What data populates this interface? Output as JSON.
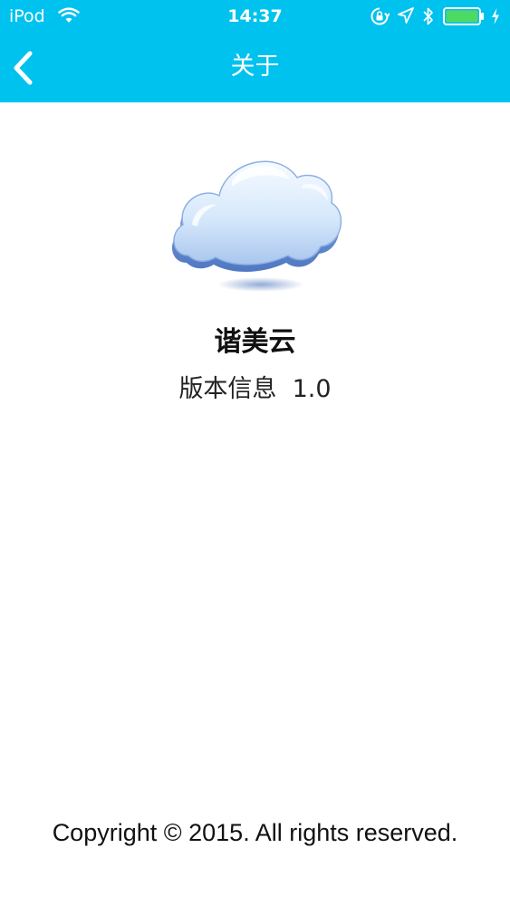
{
  "status_bar": {
    "carrier": "iPod",
    "time": "14:37",
    "icons": [
      "wifi-icon",
      "rotation-lock-icon",
      "location-icon",
      "bluetooth-icon",
      "battery-icon",
      "charging-icon"
    ],
    "battery_level": 0.85
  },
  "nav": {
    "title": "关于",
    "back_icon": "chevron-left-icon"
  },
  "about": {
    "logo_icon": "cloud-icon",
    "app_name": "谐美云",
    "version_label": "版本信息",
    "version_value": "1.0"
  },
  "footer": {
    "copyright": "Copyright © 2015. All rights reserved."
  },
  "colors": {
    "nav_background": "#00c2ee",
    "battery_fill": "#4cd964",
    "page_background": "#ffffff"
  }
}
